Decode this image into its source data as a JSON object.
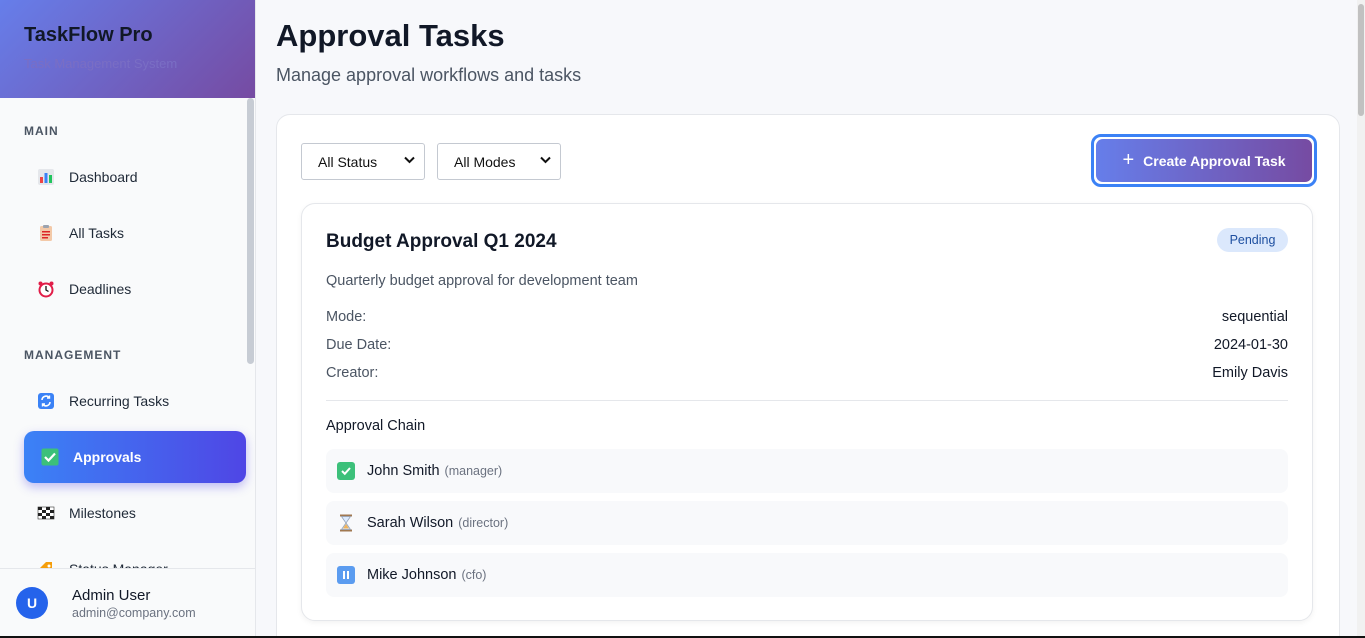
{
  "app": {
    "name": "TaskFlow Pro",
    "subtitle": "Task Management System"
  },
  "sidebar": {
    "sections": [
      {
        "title": "MAIN"
      },
      {
        "title": "MANAGEMENT"
      }
    ],
    "items": [
      {
        "label": "Dashboard",
        "icon": "bar-chart-icon"
      },
      {
        "label": "All Tasks",
        "icon": "clipboard-icon"
      },
      {
        "label": "Deadlines",
        "icon": "alarm-clock-icon"
      },
      {
        "label": "Recurring Tasks",
        "icon": "repeat-icon"
      },
      {
        "label": "Approvals",
        "icon": "check-box-icon",
        "active": true
      },
      {
        "label": "Milestones",
        "icon": "checkered-flag-icon"
      },
      {
        "label": "Status Manager",
        "icon": "tag-icon"
      }
    ]
  },
  "user": {
    "initial": "U",
    "name": "Admin User",
    "email": "admin@company.com"
  },
  "page": {
    "title": "Approval Tasks",
    "subtitle": "Manage approval workflows and tasks"
  },
  "filters": {
    "status": {
      "selected": "All Status"
    },
    "mode": {
      "selected": "All Modes"
    }
  },
  "create_button": {
    "label": "Create Approval Task"
  },
  "task": {
    "title": "Budget Approval Q1 2024",
    "status": "Pending",
    "description": "Quarterly budget approval for development team",
    "fields": [
      {
        "label": "Mode:",
        "value": "sequential"
      },
      {
        "label": "Due Date:",
        "value": "2024-01-30"
      },
      {
        "label": "Creator:",
        "value": "Emily Davis"
      }
    ],
    "chain_title": "Approval Chain",
    "chain": [
      {
        "name": "John Smith",
        "role": "(manager)",
        "state": "approved",
        "icon": "check-mark-icon"
      },
      {
        "name": "Sarah Wilson",
        "role": "(director)",
        "state": "waiting",
        "icon": "hourglass-icon"
      },
      {
        "name": "Mike Johnson",
        "role": "(cfo)",
        "state": "paused",
        "icon": "pause-icon"
      }
    ]
  },
  "colors": {
    "accent_start": "#667eea",
    "accent_end": "#764ba2",
    "active_nav": "#3b82f6",
    "approved": "#3cc07a",
    "paused": "#5b9cf0"
  }
}
